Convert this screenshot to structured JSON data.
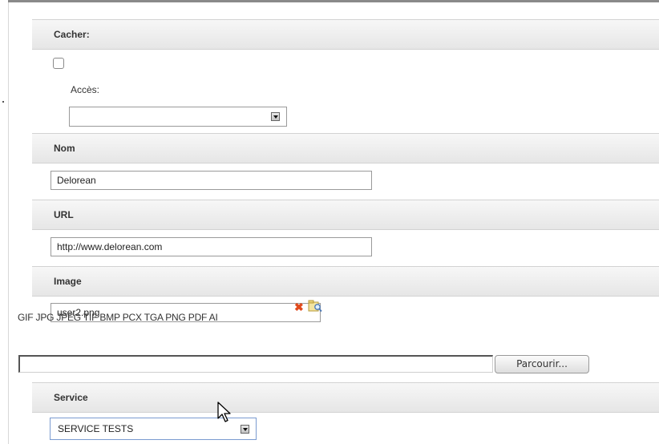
{
  "sections": {
    "cacher": {
      "title": "Cacher:",
      "checked": false,
      "access_label": "Accès:",
      "access_value": ""
    },
    "nom": {
      "title": "Nom",
      "value": "Delorean"
    },
    "url": {
      "title": "URL",
      "value": "http://www.delorean.com"
    },
    "image": {
      "title": "Image",
      "value": "user2.png",
      "formats": "GIF JPG JPEG TIF BMP PCX TGA PNG PDF AI",
      "file_value": "",
      "browse_label": "Parcourir..."
    },
    "service": {
      "title": "Service",
      "value": "SERVICE TESTS"
    }
  },
  "icons": [
    "delete-icon",
    "browse-image-icon",
    "mouse-cursor-icon",
    "dropdown-arrow-icon"
  ],
  "colors": {
    "header_bg": "#ececec",
    "delete": "#e04a1c",
    "select_focus": "#7a9bd0"
  }
}
